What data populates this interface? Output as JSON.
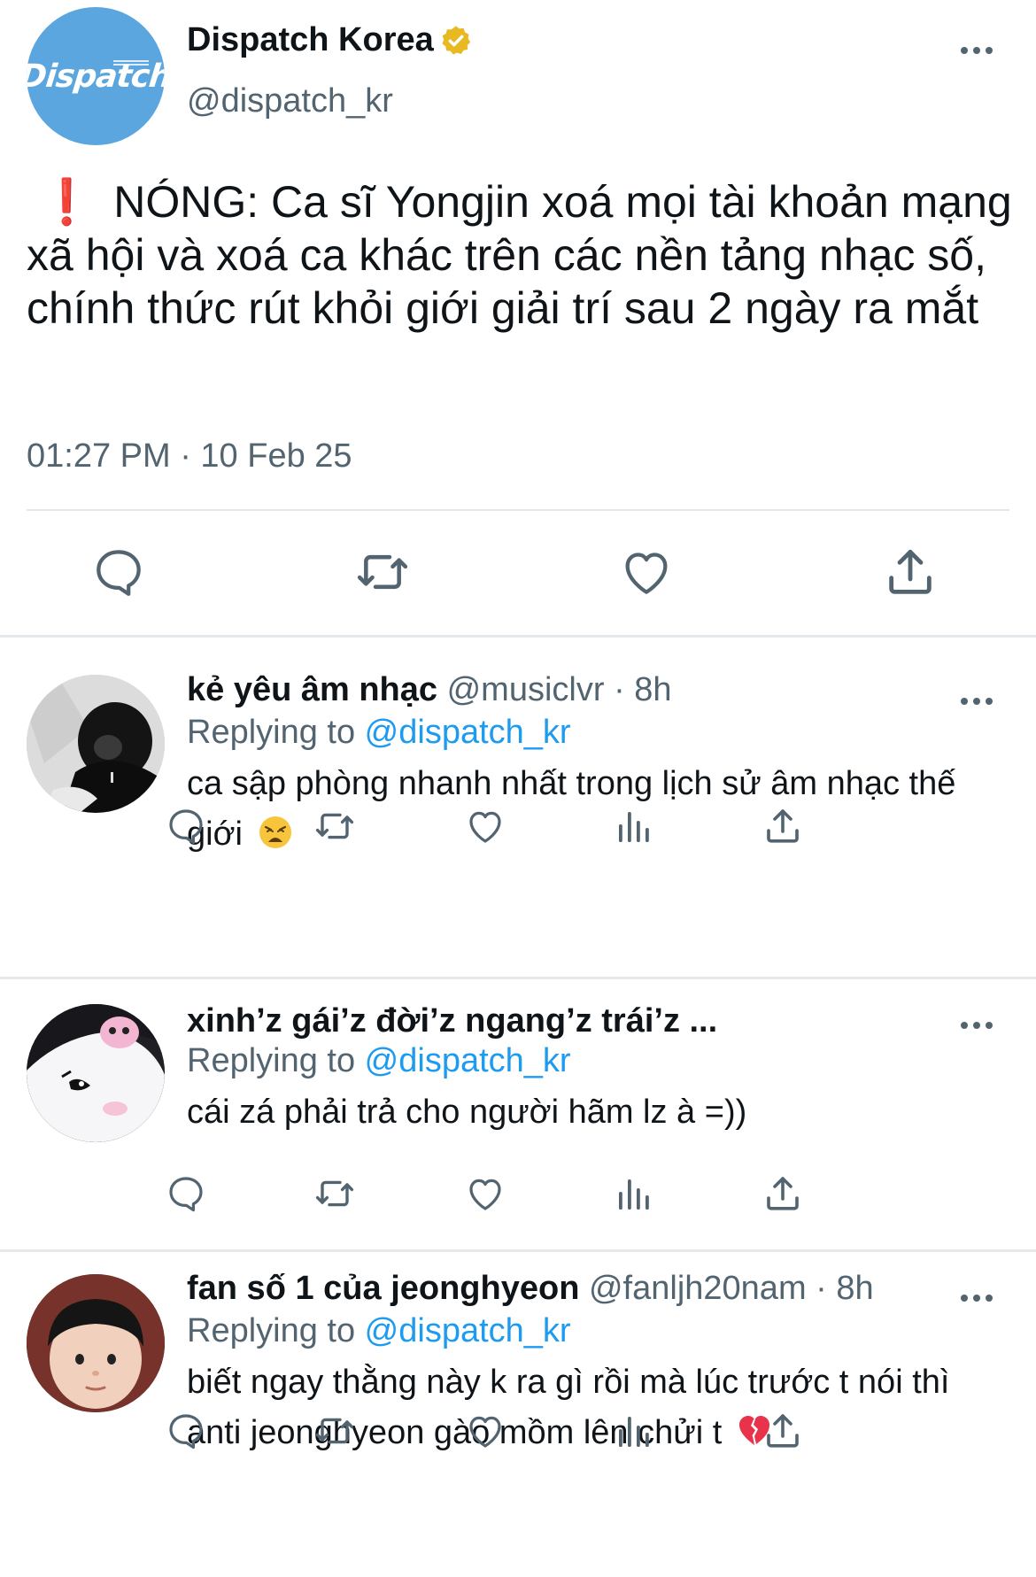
{
  "main_tweet": {
    "display_name": "Dispatch Korea",
    "handle": "@dispatch_kr",
    "avatar_logo": "Dispatch",
    "verified_badge_color": "#e8b923",
    "alert_icon": "❗",
    "text": "NÓNG: Ca sĩ Yongjin xoá mọi tài khoản mạng xã hội và xoá ca khác trên các nền tảng nhạc số, chính thức rút khỏi giới giải trí sau 2 ngày ra mắt",
    "timestamp": "01:27 PM · 10 Feb 25",
    "actions": [
      "reply-icon",
      "retweet-icon",
      "like-icon",
      "share-icon"
    ]
  },
  "replies": [
    {
      "display_name": "kẻ yêu âm nhạc",
      "handle_time": "@musiclvr · 8h",
      "replying_prefix": "Replying to ",
      "replying_to": "@dispatch_kr",
      "text": "ca sập phòng nhanh nhất trong lịch sử âm nhạc thế giới",
      "emoji": "weary-face-emoji",
      "actions": [
        "reply-icon",
        "retweet-icon",
        "like-icon",
        "views-icon",
        "share-icon"
      ]
    },
    {
      "display_name": "xinh’z gái’z đời’z ngang’z trái’z ...",
      "handle_time": "",
      "replying_prefix": "Replying to ",
      "replying_to": "@dispatch_kr",
      "text": "cái zá phải trả cho người hãm lz à =))",
      "actions": [
        "reply-icon",
        "retweet-icon",
        "like-icon",
        "views-icon",
        "share-icon"
      ]
    },
    {
      "display_name": "fan số 1 của jeonghyeon",
      "handle_time": "@fanljh20nam · 8h",
      "replying_prefix": "Replying to ",
      "replying_to": "@dispatch_kr",
      "text": "biết ngay thằng này k ra gì rồi mà lúc trước t nói thì anti jeonghyeon gào mồm lên chửi t",
      "emoji": "broken-heart-emoji",
      "actions": [
        "reply-icon",
        "retweet-icon",
        "like-icon",
        "views-icon",
        "share-icon"
      ]
    }
  ],
  "colors": {
    "text": "#0f1419",
    "secondary": "#536471",
    "link": "#1d9bf0",
    "avatar_dispatch": "#5ba6de"
  }
}
